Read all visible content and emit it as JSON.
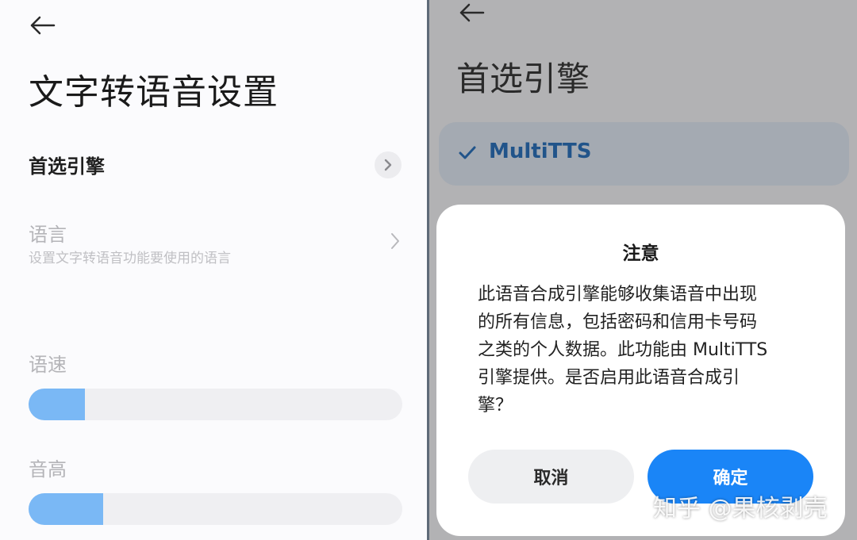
{
  "left": {
    "title": "文字转语音设置",
    "preferred_engine": {
      "label": "首选引擎",
      "icon": "chevron-right-icon"
    },
    "language": {
      "label": "语言",
      "subtitle": "设置文字转语音功能要使用的语言",
      "icon": "chevron-right-icon"
    },
    "speech_rate": {
      "label": "语速",
      "value_fraction": 0.15
    },
    "pitch": {
      "label": "音高",
      "value_fraction": 0.2
    }
  },
  "right": {
    "title": "首选引擎",
    "engine_option": {
      "label": "MultiTTS",
      "selected": true,
      "icon": "checkmark-icon"
    },
    "dialog": {
      "title": "注意",
      "body_lines": [
        "此语音合成引擎能够收集语音中出现",
        "的所有信息，包括密码和信用卡号码",
        "之类的个人数据。此功能由 MultiTTS",
        "引擎提供。是否启用此语音合成引",
        "擎？"
      ],
      "cancel_label": "取消",
      "confirm_label": "确定"
    }
  },
  "watermark": "知乎 @果核剥壳",
  "colors": {
    "accent": "#1a85f7",
    "slider_fill": "#7ab8f5",
    "engine_label": "#21548a",
    "scrim": "#b2b2b4"
  }
}
